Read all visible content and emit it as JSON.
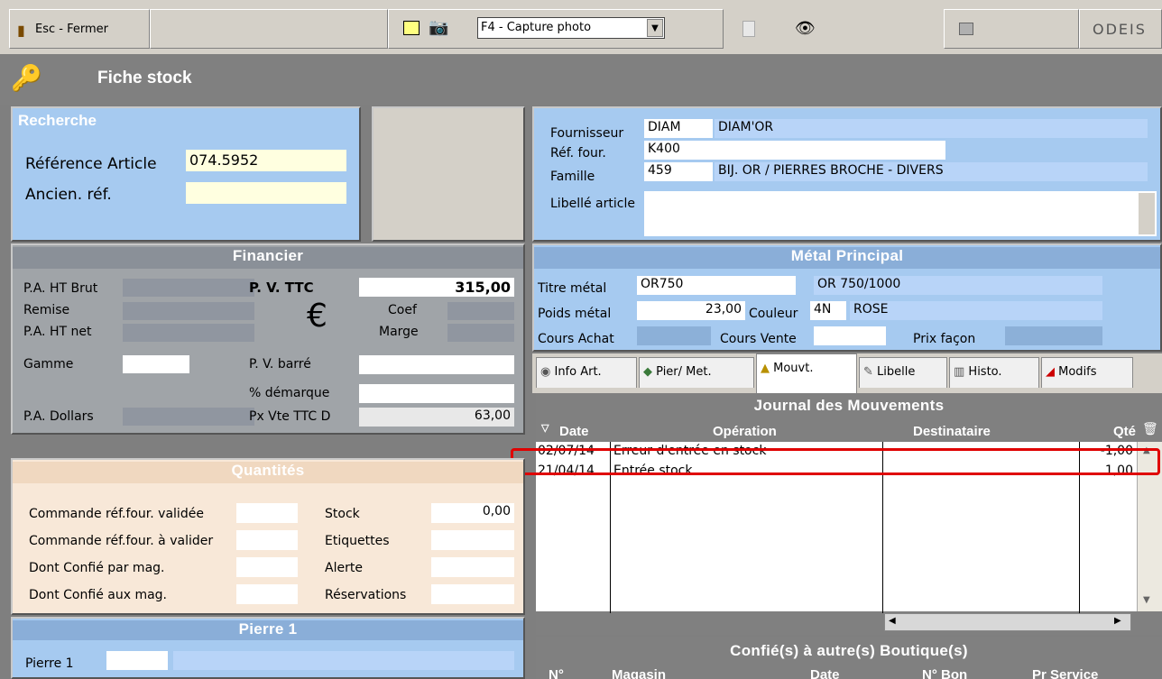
{
  "toolbar": {
    "close_label": "Esc - Fermer",
    "capture_select": "F4 - Capture photo",
    "logo_text": "ODEIS"
  },
  "title": "Fiche stock",
  "recherche": {
    "header": "Recherche",
    "ref_label": "Référence Article",
    "ref_value": "074.5952",
    "ancien_label": "Ancien. réf.",
    "ancien_value": ""
  },
  "fournisseur": {
    "label": "Fournisseur",
    "code": "DIAM",
    "name": "DIAM'OR",
    "ref_label": "Réf. four.",
    "ref_value": "K400",
    "famille_label": "Famille",
    "famille_code": "459",
    "famille_name": "BIJ. OR / PIERRES BROCHE - DIVERS",
    "libelle_label": "Libellé article",
    "libelle_value": ""
  },
  "financier": {
    "header": "Financier",
    "pa_brut_label": "P.A. HT Brut",
    "remise_label": "Remise",
    "pa_net_label": "P.A. HT net",
    "gamme_label": "Gamme",
    "pa_dollars_label": "P.A. Dollars",
    "pv_ttc_label": "P. V. TTC",
    "pv_ttc_value": "315,00",
    "coef_label": "Coef",
    "marge_label": "Marge",
    "pv_barre_label": "P. V. barré",
    "demarque_label": "% démarque",
    "px_vte_label": "Px Vte TTC D",
    "px_vte_value": "63,00",
    "euro_symbol": "€"
  },
  "metal": {
    "header": "Métal Principal",
    "titre_label": "Titre métal",
    "titre_code": "OR750",
    "titre_name": "OR 750/1000",
    "poids_label": "Poids métal",
    "poids_value": "23,00",
    "couleur_label": "Couleur",
    "couleur_code": "4N",
    "couleur_name": "ROSE",
    "cours_achat_label": "Cours Achat",
    "cours_vente_label": "Cours Vente",
    "prix_facon_label": "Prix façon"
  },
  "tabs": [
    {
      "label": "Info Art."
    },
    {
      "label": "Pier/ Met."
    },
    {
      "label": "Mouvt."
    },
    {
      "label": "Libelle"
    },
    {
      "label": "Histo."
    },
    {
      "label": "Modifs"
    }
  ],
  "journal": {
    "header": "Journal des Mouvements",
    "columns": [
      "Date",
      "Opération",
      "Destinataire",
      "Qté"
    ],
    "rows": [
      {
        "date": "02/07/14",
        "operation": "Erreur d'entrée en stock",
        "destinataire": "",
        "qte": "-1,00"
      },
      {
        "date": "21/04/14",
        "operation": "Entrée stock",
        "destinataire": "",
        "qte": "1,00"
      }
    ]
  },
  "quantites": {
    "header": "Quantités",
    "cmd_validee_label": "Commande réf.four. validée",
    "cmd_avalider_label": "Commande réf.four. à valider",
    "confie_par_label": "Dont Confié par mag.",
    "confie_aux_label": "Dont Confié aux mag.",
    "stock_label": "Stock",
    "stock_value": "0,00",
    "etiquettes_label": "Etiquettes",
    "alerte_label": "Alerte",
    "reservations_label": "Réservations"
  },
  "pierre": {
    "header": "Pierre 1",
    "label": "Pierre 1"
  },
  "confies": {
    "header": "Confié(s)  à autre(s) Boutique(s)",
    "columns": [
      "N°",
      "Magasin",
      "Date",
      "N° Bon",
      "Pr Service"
    ]
  },
  "colors": {
    "highlight": "#e00000",
    "blue_panel": "#a6caf0",
    "gray_panel": "#a0a4a8",
    "beige_panel": "#f8e8d8"
  }
}
